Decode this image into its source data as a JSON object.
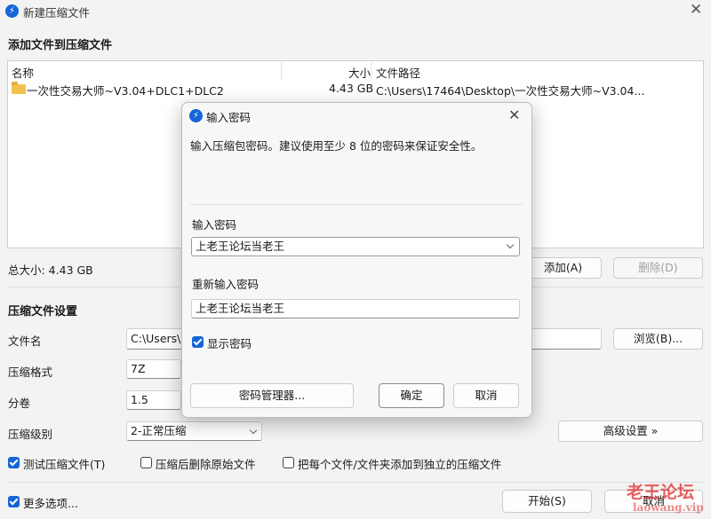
{
  "window": {
    "title": "新建压缩文件",
    "close_glyph": "✕"
  },
  "add_section": {
    "heading": "添加文件到压缩文件"
  },
  "file_list": {
    "columns": {
      "name": "名称",
      "size": "大小",
      "path": "文件路径"
    },
    "rows": [
      {
        "icon": "folder-icon",
        "name": "一次性交易大师~V3.04+DLC1+DLC2",
        "size": "4.43 GB",
        "path": "C:\\Users\\17464\\Desktop\\一次性交易大师~V3.04..."
      }
    ]
  },
  "total_size": "总大小: 4.43 GB",
  "buttons": {
    "add": "添加(A)",
    "remove": "删除(D)",
    "browse": "浏览(B)...",
    "advanced": "高级设置 »",
    "start": "开始(S)",
    "cancel": "取消"
  },
  "settings": {
    "heading": "压缩文件设置",
    "filename": {
      "label": "文件名",
      "value": "C:\\Users\\1"
    },
    "format": {
      "label": "压缩格式",
      "value": "7Z"
    },
    "volume": {
      "label": "分卷",
      "value": "1.5"
    },
    "level": {
      "label": "压缩级别",
      "value": "2-正常压缩"
    }
  },
  "options": {
    "test": {
      "label": "测试压缩文件(T)",
      "checked": true
    },
    "delete_after": {
      "label": "压缩后删除原始文件",
      "checked": false
    },
    "separate": {
      "label": "把每个文件/文件夹添加到独立的压缩文件",
      "checked": false
    },
    "more": {
      "label": "更多选项...",
      "checked": true
    }
  },
  "dialog": {
    "title": "输入密码",
    "close_glyph": "✕",
    "description": "输入压缩包密码。建议使用至少 8 位的密码来保证安全性。",
    "password_label": "输入密码",
    "password_value": "上老王论坛当老王",
    "repeat_label": "重新输入密码",
    "repeat_value": "上老王论坛当老王",
    "show_password": {
      "label": "显示密码",
      "checked": true
    },
    "manager_button": "密码管理器...",
    "ok_button": "确定",
    "cancel_button": "取消"
  },
  "watermark": {
    "title": "老王论坛",
    "url": "laowang.vip"
  },
  "colors": {
    "accent": "#1565d8",
    "watermark": "#e02a2a",
    "background": "#f3f3f3"
  }
}
